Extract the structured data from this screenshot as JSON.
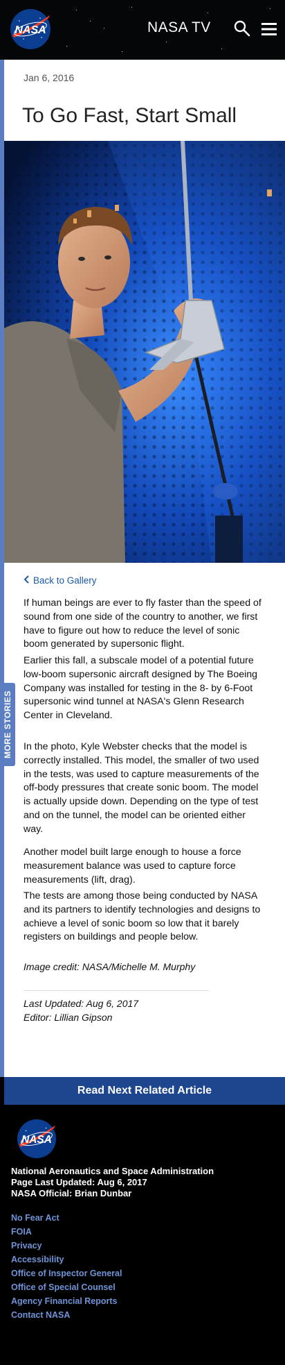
{
  "header": {
    "nav_title": "NASA TV"
  },
  "article": {
    "date": "Jan 6, 2016",
    "title": "To Go Fast, Start Small",
    "back_link": "Back to Gallery",
    "paragraphs": [
      "If human beings are ever to fly faster than the speed of sound from one side of the country to another, we first have to figure out how to reduce the level of sonic boom generated by supersonic flight.",
      "Earlier this fall, a subscale model of a potential future low-boom supersonic aircraft designed by The Boeing Company was installed for testing in the 8- by 6-Foot supersonic wind tunnel at NASA's Glenn Research Center in Cleveland.",
      "In the photo, Kyle Webster checks that the model is correctly installed. This model, the smaller of two used in the tests, was used to capture measurements of the off-body pressures that create sonic boom. The model is actually upside down. Depending on the type of test and on the tunnel, the model can be oriented either way.",
      "Another model built large enough to house a force measurement balance was used to capture force measurements (lift, drag).",
      "The tests are among those being conducted by NASA and its partners to identify technologies and designs to achieve a level of sonic boom so low that it barely registers on buildings and people below."
    ],
    "image_credit": "Image credit: NASA/Michelle M. Murphy",
    "last_updated": "Last Updated: Aug 6, 2017",
    "editor": "Editor: Lillian Gipson"
  },
  "more_stories_label": "MORE STORIES",
  "read_next_label": "Read Next Related Article",
  "footer": {
    "agency": "National Aeronautics and Space Administration",
    "page_updated": "Page Last Updated: Aug 6, 2017",
    "official": "NASA Official: Brian Dunbar",
    "links": [
      "No Fear Act",
      "FOIA",
      "Privacy",
      "Accessibility",
      "Office of Inspector General",
      "Office of Special Counsel",
      "Agency Financial Reports",
      "Contact NASA"
    ]
  },
  "colors": {
    "accent_blue": "#5b7ec2",
    "link_blue": "#1a5aa6",
    "footer_link": "#6f93d6",
    "read_next_bar": "#1e468f"
  },
  "logo_text": "NASA"
}
